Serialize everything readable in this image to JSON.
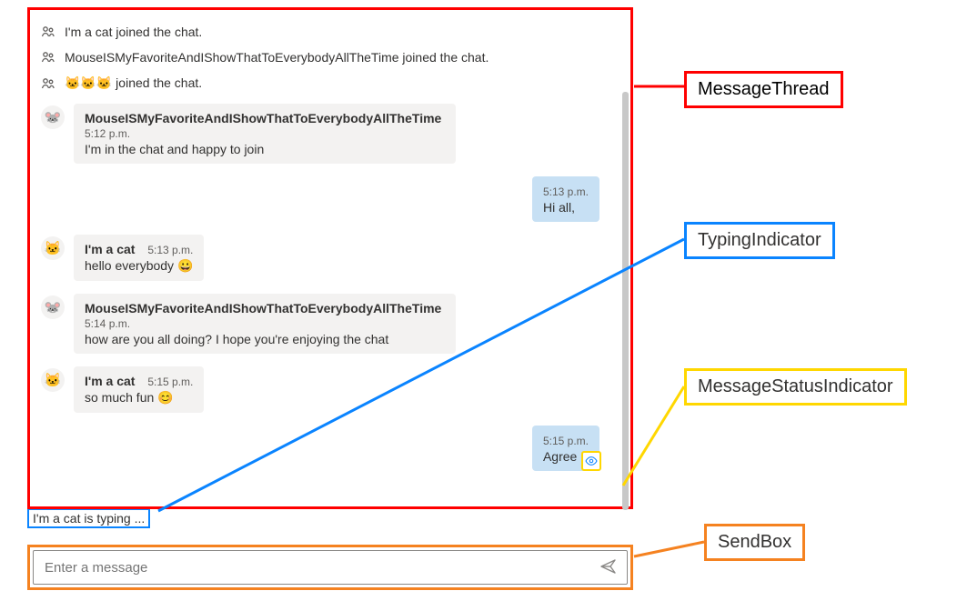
{
  "system_events": [
    {
      "text": "I'm a cat joined the chat."
    },
    {
      "text": "MouseISMyFavoriteAndIShowThatToEverybodyAllTheTime joined the chat."
    },
    {
      "text": "🐱🐱🐱 joined the chat."
    }
  ],
  "messages": [
    {
      "mine": false,
      "avatar": "🐭",
      "name": "MouseISMyFavoriteAndIShowThatToEverybodyAllTheTime",
      "time": "5:12 p.m.",
      "text": "I'm in the chat and happy to join"
    },
    {
      "mine": true,
      "time": "5:13 p.m.",
      "text": "Hi all,"
    },
    {
      "mine": false,
      "avatar": "🐱",
      "name": "I'm a cat",
      "time": "5:13 p.m.",
      "text": "hello everybody 😀"
    },
    {
      "mine": false,
      "avatar": "🐭",
      "name": "MouseISMyFavoriteAndIShowThatToEverybodyAllTheTime",
      "time": "5:14 p.m.",
      "text": "how are you all doing? I hope you're enjoying the chat"
    },
    {
      "mine": false,
      "avatar": "🐱",
      "name": "I'm a cat",
      "time": "5:15 p.m.",
      "text": "so much fun 😊"
    },
    {
      "mine": true,
      "time": "5:15 p.m.",
      "text": "Agree :)",
      "status": "seen"
    }
  ],
  "typing_indicator": "I'm a cat is typing ...",
  "sendbox": {
    "placeholder": "Enter a message"
  },
  "callouts": {
    "message_thread": "MessageThread",
    "typing_indicator": "TypingIndicator",
    "message_status_indicator": "MessageStatusIndicator",
    "send_box": "SendBox"
  },
  "colors": {
    "red": "#ff0000",
    "blue": "#0a84ff",
    "yellow": "#ffd700",
    "orange": "#f58220",
    "bubble_other": "#f3f2f1",
    "bubble_mine": "#c7e0f4"
  }
}
